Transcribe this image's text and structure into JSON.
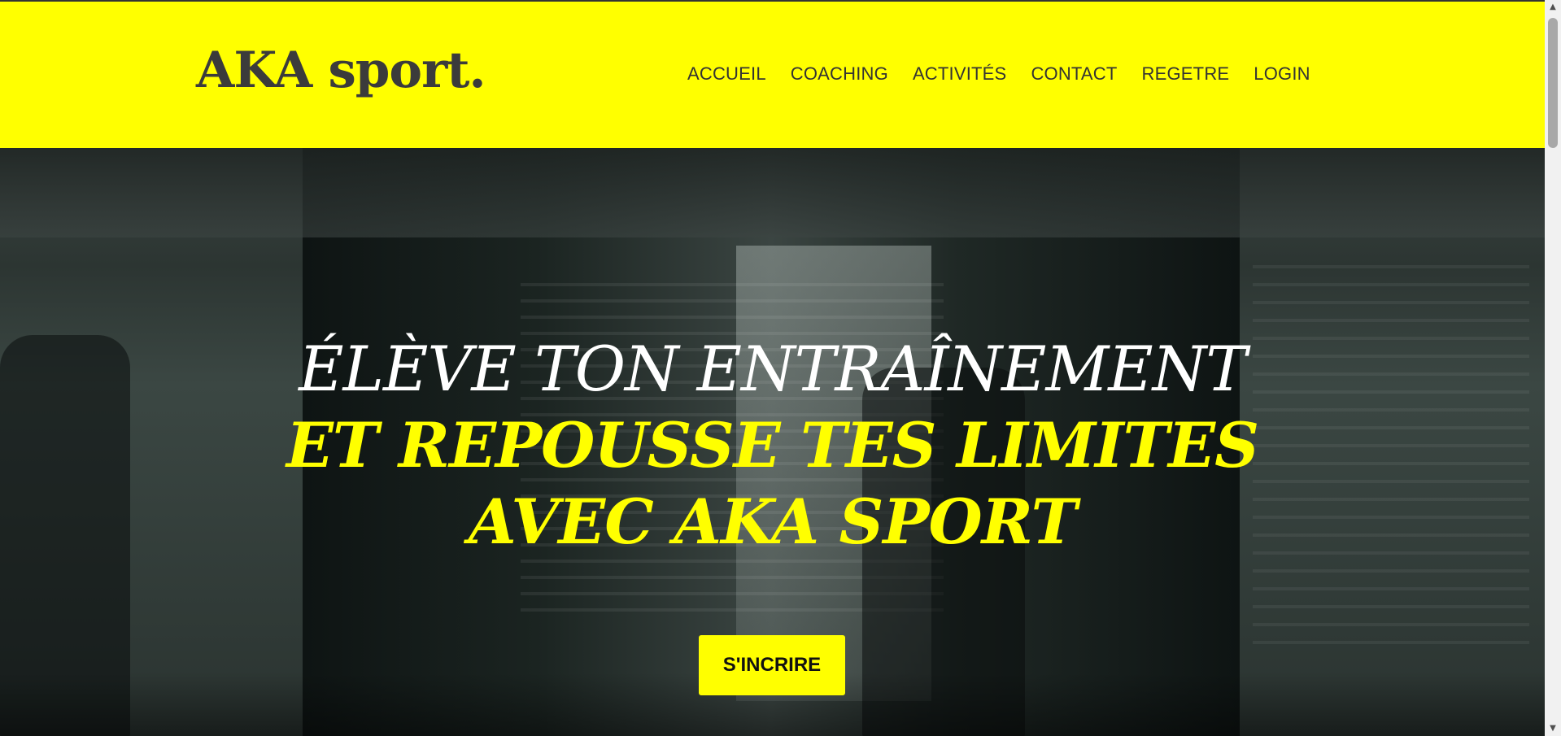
{
  "header": {
    "logo": "AKA sport.",
    "nav": {
      "accueil": "ACCUEIL",
      "coaching": "COACHING",
      "activites": "ACTIVITÉS",
      "contact": "CONTACT",
      "regetre": "REGETRE",
      "login": "LOGIN"
    }
  },
  "hero": {
    "line1": "ÉLÈVE TON ENTRAÎNEMENT",
    "line2": "ET REPOUSSE TES LIMITES",
    "line3": "AVEC AKA SPORT",
    "cta_label": "S'INCRIRE"
  },
  "scrollbar": {
    "up_icon": "▲",
    "down_icon": "▼"
  },
  "colors": {
    "accent": "#ffff00",
    "header_text": "#333333",
    "headline_white": "#ffffff"
  }
}
